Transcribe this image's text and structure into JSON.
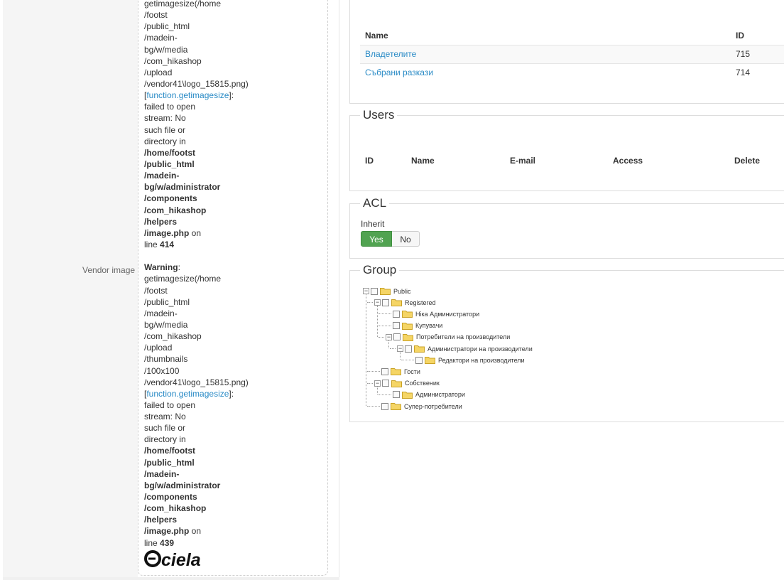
{
  "form": {
    "vendor_image_label": "Vendor image",
    "message_lines": [
      {
        "t": "getimagesize(/home",
        "s": "n"
      },
      {
        "t": "/footst",
        "s": "n"
      },
      {
        "t": "/public_html",
        "s": "n"
      },
      {
        "t": "/madein-",
        "s": "n"
      },
      {
        "t": "bg/w/media",
        "s": "n"
      },
      {
        "t": "/com_hikashop",
        "s": "n"
      },
      {
        "t": "/upload",
        "s": "n"
      },
      {
        "t": "/vendor41\\logo_15815.png)",
        "s": "n"
      },
      {
        "t": "[function.getimagesize]:",
        "s": "link"
      },
      {
        "t": "failed to open",
        "s": "n"
      },
      {
        "t": "stream: No",
        "s": "n"
      },
      {
        "t": "such file or",
        "s": "n"
      },
      {
        "t": "directory in",
        "s": "n"
      },
      {
        "t": "/home/footst",
        "s": "b"
      },
      {
        "t": "/public_html",
        "s": "b"
      },
      {
        "t": "/madein-",
        "s": "b"
      },
      {
        "t": "bg/w/administrator",
        "s": "b"
      },
      {
        "t": "/components",
        "s": "b"
      },
      {
        "t": "/com_hikashop",
        "s": "b"
      },
      {
        "t": "/helpers",
        "s": "b"
      },
      {
        "t": "/image.php on",
        "s": "bon"
      },
      {
        "t": "line 414",
        "s": "line"
      },
      {
        "t": "",
        "s": "n"
      },
      {
        "t": "Warning:",
        "s": "warn"
      },
      {
        "t": "getimagesize(/home",
        "s": "n"
      },
      {
        "t": "/footst",
        "s": "n"
      },
      {
        "t": "/public_html",
        "s": "n"
      },
      {
        "t": "/madein-",
        "s": "n"
      },
      {
        "t": "bg/w/media",
        "s": "n"
      },
      {
        "t": "/com_hikashop",
        "s": "n"
      },
      {
        "t": "/upload",
        "s": "n"
      },
      {
        "t": "/thumbnails",
        "s": "n"
      },
      {
        "t": "/100x100",
        "s": "n"
      },
      {
        "t": "/vendor41\\logo_15815.png)",
        "s": "n"
      },
      {
        "t": "[function.getimagesize]:",
        "s": "link"
      },
      {
        "t": "failed to open",
        "s": "n"
      },
      {
        "t": "stream: No",
        "s": "n"
      },
      {
        "t": "such file or",
        "s": "n"
      },
      {
        "t": "directory in",
        "s": "n"
      },
      {
        "t": "/home/footst",
        "s": "b"
      },
      {
        "t": "/public_html",
        "s": "b"
      },
      {
        "t": "/madein-",
        "s": "b"
      },
      {
        "t": "bg/w/administrator",
        "s": "b"
      },
      {
        "t": "/components",
        "s": "b"
      },
      {
        "t": "/com_hikashop",
        "s": "b"
      },
      {
        "t": "/helpers",
        "s": "b"
      },
      {
        "t": "/image.php on",
        "s": "bon"
      },
      {
        "t": "line 439",
        "s": "line"
      }
    ],
    "logo_text": "ciela"
  },
  "categories": {
    "columns": {
      "name": "Name",
      "id": "ID"
    },
    "rows": [
      {
        "name": "Владетелите",
        "id": "715"
      },
      {
        "name": "Събрани разкази",
        "id": "714"
      }
    ]
  },
  "users": {
    "legend": "Users",
    "columns": {
      "id": "ID",
      "name": "Name",
      "email": "E-mail",
      "access": "Access",
      "delete": "Delete"
    }
  },
  "acl": {
    "legend": "ACL",
    "inherit_label": "Inherit",
    "yes_label": "Yes",
    "no_label": "No",
    "selected": "Yes"
  },
  "group": {
    "legend": "Group",
    "tree": [
      {
        "label": "Public",
        "depth": 0,
        "toggle": "-"
      },
      {
        "label": "Registered",
        "depth": 1,
        "toggle": "-"
      },
      {
        "label": "Ніка Администратори",
        "depth": 2,
        "toggle": ""
      },
      {
        "label": "Купувачи",
        "depth": 2,
        "toggle": ""
      },
      {
        "label": "Потребители на производители",
        "depth": 2,
        "toggle": "-"
      },
      {
        "label": "Администратори на производители",
        "depth": 3,
        "toggle": "-"
      },
      {
        "label": "Редактори на производители",
        "depth": 4,
        "toggle": ""
      },
      {
        "label": "Гости",
        "depth": 1,
        "toggle": ""
      },
      {
        "label": "Собственик",
        "depth": 1,
        "toggle": "-"
      },
      {
        "label": "Администратори",
        "depth": 2,
        "toggle": ""
      },
      {
        "label": "Супер-потребители",
        "depth": 1,
        "toggle": ""
      }
    ]
  },
  "colors": {
    "accent": "#51a351",
    "link": "#2a8bc6"
  }
}
